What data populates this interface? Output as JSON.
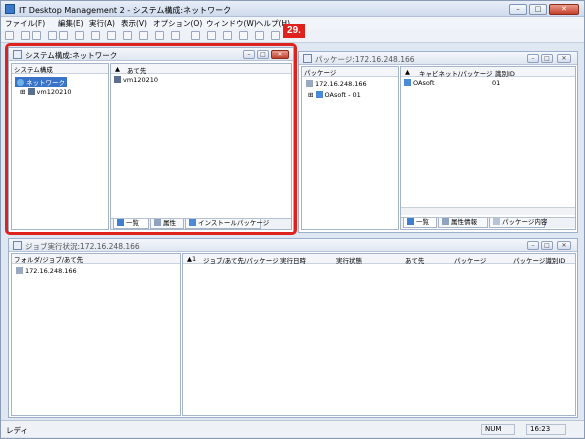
{
  "app": {
    "title": "IT Desktop Management 2 - システム構成:ネットワーク"
  },
  "menu": [
    "ファイル(F)",
    "編集(E)",
    "実行(A)",
    "表示(V)",
    "オプション(O)",
    "ウィンドウ(W)",
    "ヘルプ(H)"
  ],
  "callout": {
    "number": "29."
  },
  "system_pane": {
    "title": "システム構成:ネットワーク",
    "tree_header": "システム構成",
    "tree": [
      {
        "label": "ネットワーク"
      },
      {
        "label": "vm120210"
      }
    ],
    "list_header": "あて先",
    "list_rows": [
      "vm120210"
    ],
    "tabs": [
      "一覧",
      "属性",
      "インストールパッケージ"
    ]
  },
  "package_pane": {
    "title": "パッケージ:172.16.248.166",
    "tree_header": "パッケージ",
    "tree": [
      {
        "label": "172.16.248.166"
      },
      {
        "label": "OAsoft - 01"
      }
    ],
    "list_headers": [
      "キャビネット/パッケージ",
      "識別ID"
    ],
    "list_rows": [
      {
        "name": "OAsoft",
        "id": "01"
      }
    ],
    "tabs": [
      "一覧",
      "属性情報",
      "パッケージ内容"
    ]
  },
  "job_pane": {
    "title": "ジョブ実行状況:172.16.248.166",
    "tree_header": "フォルダ/ジョブ/あて先",
    "tree": [
      {
        "label": "172.16.248.166"
      }
    ],
    "list_headers": [
      "1",
      "ジョブ/あて先/パッケージ",
      "実行日時",
      "実行状態",
      "あて先",
      "パッケージ",
      "パッケージ識別ID"
    ]
  },
  "statusbar": {
    "left": "レディ",
    "num": "NUM",
    "time": "16:23"
  }
}
